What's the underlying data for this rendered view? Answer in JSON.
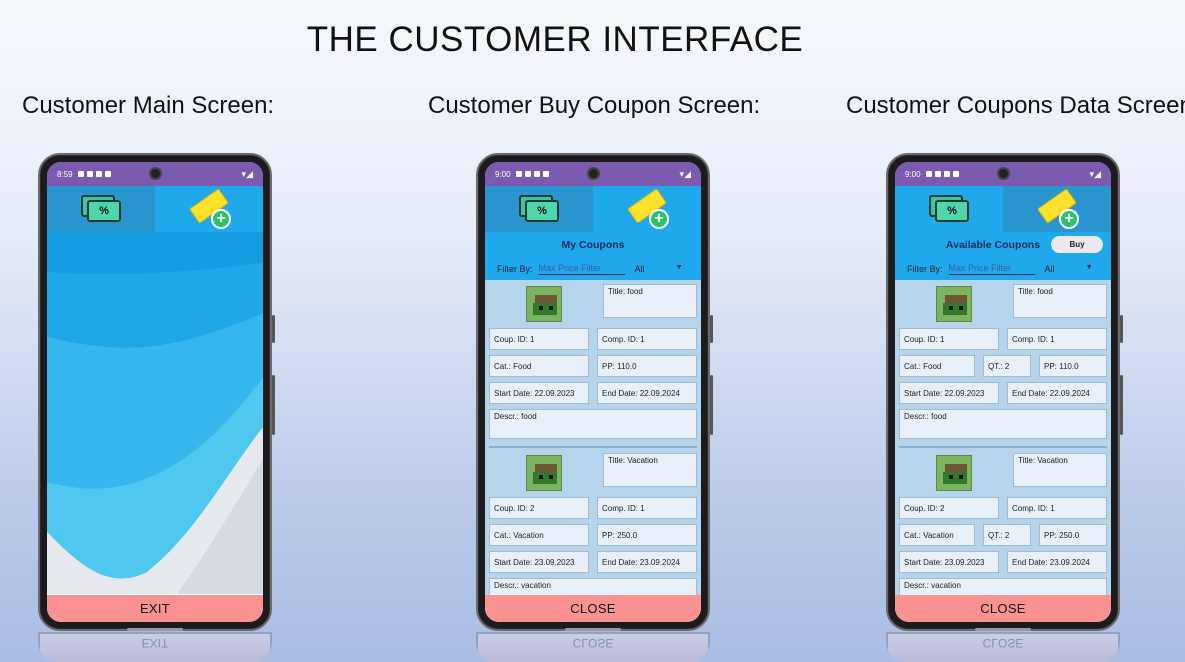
{
  "page": {
    "title": "THE CUSTOMER INTERFACE",
    "headings": [
      "Customer Main Screen:",
      "Customer Buy Coupon Screen:",
      "Customer Coupons Data Screen:"
    ]
  },
  "phones": [
    {
      "time": "8:59",
      "footer_button": "EXIT",
      "reflection_text": "EXIT"
    },
    {
      "time": "9:00",
      "list_title": "My Coupons",
      "filter_label": "Filter By:",
      "filter_placeholder": "Max Price Filter",
      "filter_select": "All",
      "footer_button": "CLOSE",
      "reflection_text": "CLOSE",
      "coupons": [
        {
          "title": "Title: food",
          "coup_id": "Coup. ID: 1",
          "comp_id": "Comp. ID: 1",
          "cat": "Cat.: Food",
          "pp": "PP: 110.0",
          "start": "Start Date: 22.09.2023",
          "end": "End Date: 22.09.2024",
          "descr": "Descr.: food"
        },
        {
          "title": "Title: Vacation",
          "coup_id": "Coup. ID: 2",
          "comp_id": "Comp. ID: 1",
          "cat": "Cat.: Vacation",
          "pp": "PP: 250.0",
          "start": "Start Date: 23.09.2023",
          "end": "End Date: 23.09.2024",
          "descr": "Descr.: vacation"
        }
      ]
    },
    {
      "time": "9:00",
      "list_title": "Available Coupons",
      "buy_button": "Buy",
      "filter_label": "Filter By:",
      "filter_placeholder": "Max Price Filter",
      "filter_select": "All",
      "footer_button": "CLOSE",
      "reflection_text": "CLOSE",
      "coupons": [
        {
          "title": "Title: food",
          "coup_id": "Coup. ID: 1",
          "comp_id": "Comp. ID: 1",
          "cat": "Cat.: Food",
          "qt": "QT.: 2",
          "pp": "PP: 110.0",
          "start": "Start Date: 22.09.2023",
          "end": "End Date: 22.09.2024",
          "descr": "Descr.: food"
        },
        {
          "title": "Title: Vacation",
          "coup_id": "Coup. ID: 2",
          "comp_id": "Comp. ID: 1",
          "cat": "Cat.: Vacation",
          "qt": "QT.: 2",
          "pp": "PP: 250.0",
          "start": "Start Date: 23.09.2023",
          "end": "End Date: 23.09.2024",
          "descr": "Descr.: vacation"
        }
      ]
    }
  ],
  "icons": {
    "my_coupons_tab": "coupon-percent-icon",
    "buy_tab": "ticket-add-icon",
    "coupon_image": "pixel-art-icon"
  },
  "colors": {
    "status_bar": "#7b5bb0",
    "tab_bar": "#1fa9ec",
    "footer_button": "#fa9292",
    "list_bg": "#b6d5ec"
  }
}
